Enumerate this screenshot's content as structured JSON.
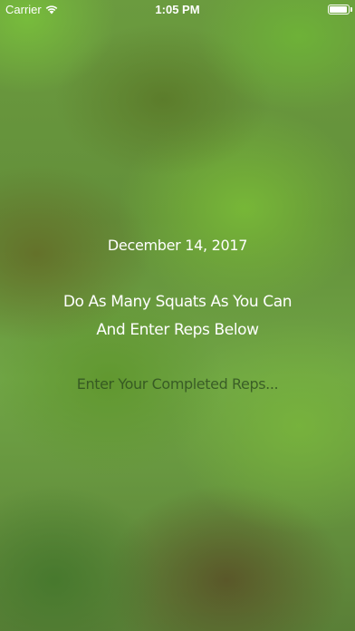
{
  "status_bar": {
    "carrier": "Carrier",
    "wifi_icon": "wifi-icon",
    "time": "1:05 PM",
    "battery_icon": "battery-full-icon"
  },
  "workout": {
    "date": "December 14, 2017",
    "instruction_line1": "Do As Many Squats As You Can",
    "instruction_line2": "And Enter Reps Below",
    "reps_input": {
      "value": "",
      "placeholder": "Enter Your Completed Reps..."
    }
  },
  "colors": {
    "background": "#5e8c3c",
    "text": "#ffffff",
    "placeholder": "#3a5a2a"
  }
}
